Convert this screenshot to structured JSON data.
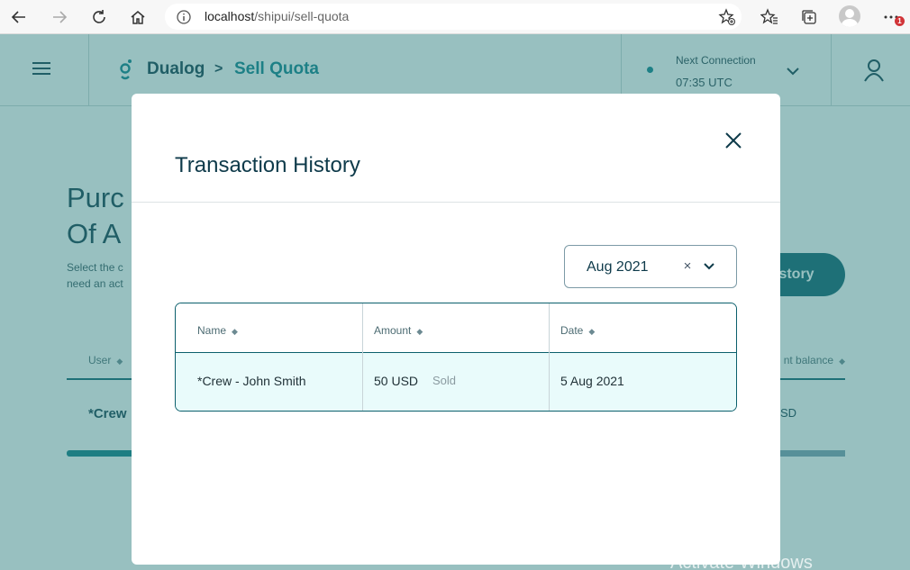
{
  "browser": {
    "url_host": "localhost",
    "url_path": "/shipui/sell-quota",
    "notification_count": "1"
  },
  "app": {
    "brand": "Dualog",
    "breadcrumb_separator": ">",
    "breadcrumb_current": "Sell Quota",
    "connection_label": "Next Connection",
    "connection_time": "07:35 UTC",
    "page_title_line1": "Purc",
    "page_title_line2": "Of A",
    "page_desc_line1": "Select the c",
    "page_desc_line2": "need an act",
    "history_button_label": "istory",
    "bg_table": {
      "col_user": "User",
      "col_balance": "nt balance",
      "row_user": "*Crew",
      "row_balance": "SD"
    }
  },
  "modal": {
    "title": "Transaction History",
    "month_filter": "Aug 2021",
    "clear_symbol": "×",
    "table": {
      "headers": [
        "Name",
        "Amount",
        "Date"
      ],
      "rows": [
        {
          "name": "*Crew - John Smith",
          "amount": "50 USD",
          "status": "Sold",
          "date": "5 Aug 2021"
        }
      ]
    }
  },
  "os": {
    "watermark": "Activate Windows"
  },
  "colors": {
    "primary": "#0b5f6c",
    "accent": "#087e8b",
    "row_highlight": "#e9fbfb",
    "overlay": "#6aa8a8"
  }
}
